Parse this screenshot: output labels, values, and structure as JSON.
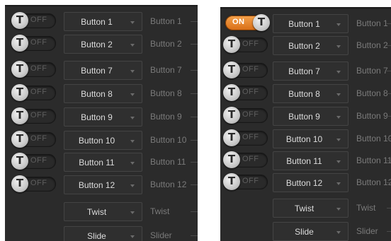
{
  "colors": {
    "panel_bg": "#2b2b2b",
    "button_text": "#dcdcdc",
    "side_text": "#7a7a7a",
    "toggle_on": "#f08b2c",
    "toggle_off_text": "#5e5e5e"
  },
  "panels": [
    {
      "rows": [
        {
          "toggle": {
            "state": "off",
            "knob_letter": "T",
            "label": "OFF"
          },
          "button": "Button 1",
          "side_label": "Button 1"
        },
        {
          "toggle": {
            "state": "off",
            "knob_letter": "T",
            "label": "OFF"
          },
          "button": "Button 2",
          "side_label": "Button 2"
        },
        {
          "toggle": {
            "state": "off",
            "knob_letter": "T",
            "label": "OFF"
          },
          "button": "Button 7",
          "side_label": "Button 7"
        },
        {
          "toggle": {
            "state": "off",
            "knob_letter": "T",
            "label": "OFF"
          },
          "button": "Button 8",
          "side_label": "Button 8"
        },
        {
          "toggle": {
            "state": "off",
            "knob_letter": "T",
            "label": "OFF"
          },
          "button": "Button 9",
          "side_label": "Button 9"
        },
        {
          "toggle": {
            "state": "off",
            "knob_letter": "T",
            "label": "OFF"
          },
          "button": "Button 10",
          "side_label": "Button 10"
        },
        {
          "toggle": {
            "state": "off",
            "knob_letter": "T",
            "label": "OFF"
          },
          "button": "Button 11",
          "side_label": "Button 11"
        },
        {
          "toggle": {
            "state": "off",
            "knob_letter": "T",
            "label": "OFF"
          },
          "button": "Button 12",
          "side_label": "Button 12"
        },
        {
          "toggle": null,
          "button": "Twist",
          "side_label": "Twist"
        },
        {
          "toggle": null,
          "button": "Slide",
          "side_label": "Slider"
        }
      ]
    },
    {
      "rows": [
        {
          "toggle": {
            "state": "on",
            "knob_letter": "T",
            "label": "ON"
          },
          "button": "Button 1",
          "side_label": "Button 1"
        },
        {
          "toggle": {
            "state": "off",
            "knob_letter": "T",
            "label": "OFF"
          },
          "button": "Button 2",
          "side_label": "Button 2"
        },
        {
          "toggle": {
            "state": "off",
            "knob_letter": "T",
            "label": "OFF"
          },
          "button": "Button 7",
          "side_label": "Button 7"
        },
        {
          "toggle": {
            "state": "off",
            "knob_letter": "T",
            "label": "OFF"
          },
          "button": "Button 8",
          "side_label": "Button 8"
        },
        {
          "toggle": {
            "state": "off",
            "knob_letter": "T",
            "label": "OFF"
          },
          "button": "Button 9",
          "side_label": "Button 9"
        },
        {
          "toggle": {
            "state": "off",
            "knob_letter": "T",
            "label": "OFF"
          },
          "button": "Button 10",
          "side_label": "Button 10"
        },
        {
          "toggle": {
            "state": "off",
            "knob_letter": "T",
            "label": "OFF"
          },
          "button": "Button 11",
          "side_label": "Button 11"
        },
        {
          "toggle": {
            "state": "off",
            "knob_letter": "T",
            "label": "OFF"
          },
          "button": "Button 12",
          "side_label": "Button 12"
        },
        {
          "toggle": null,
          "button": "Twist",
          "side_label": "Twist"
        },
        {
          "toggle": null,
          "button": "Slide",
          "side_label": "Slider"
        }
      ]
    }
  ]
}
